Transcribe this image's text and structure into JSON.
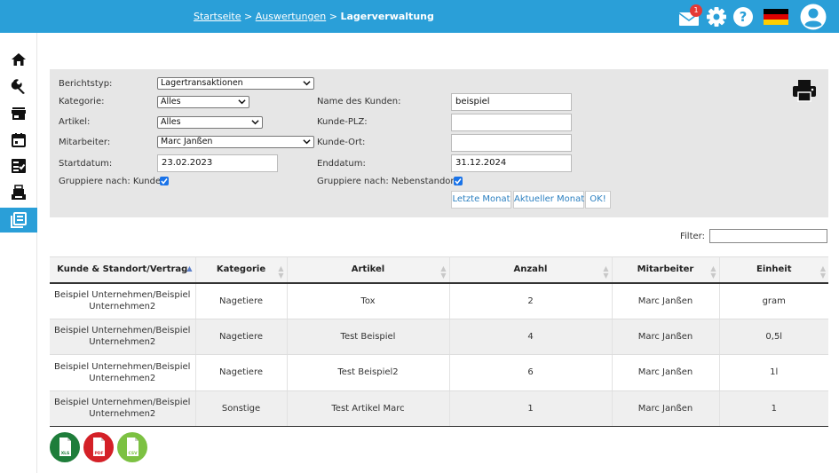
{
  "header": {
    "breadcrumb": {
      "home": "Startseite",
      "sep1": ">",
      "reports": "Auswertungen",
      "sep2": ">",
      "current": "Lagerverwaltung"
    },
    "mail_badge": "1",
    "accent": "#2a9fd8"
  },
  "sidebar": {
    "items": [
      {
        "name": "home-icon"
      },
      {
        "name": "wrench-icon"
      },
      {
        "name": "store-icon"
      },
      {
        "name": "calendar-icon"
      },
      {
        "name": "checklist-icon"
      },
      {
        "name": "register-icon"
      },
      {
        "name": "report-icon",
        "active": true
      }
    ]
  },
  "filters": {
    "report_type": {
      "label": "Berichtstyp:",
      "value": "Lagertransaktionen"
    },
    "category": {
      "label": "Kategorie:",
      "value": "Alles"
    },
    "article": {
      "label": "Artikel:",
      "value": "Alles"
    },
    "employee": {
      "label": "Mitarbeiter:",
      "value": "Marc Janßen"
    },
    "start_date": {
      "label": "Startdatum:",
      "value": "23.02.2023"
    },
    "group_customer": {
      "label": "Gruppiere nach: Kunde:",
      "checked": true
    },
    "customer_name": {
      "label": "Name des Kunden:",
      "value": "beispiel"
    },
    "customer_zip": {
      "label": "Kunde-PLZ:",
      "value": ""
    },
    "customer_city": {
      "label": "Kunde-Ort:",
      "value": ""
    },
    "end_date": {
      "label": "Enddatum:",
      "value": "31.12.2024"
    },
    "group_site": {
      "label": "Gruppiere nach: Nebenstandort:",
      "checked": true
    },
    "buttons": {
      "last_month": "Letzte Monat",
      "current_month": "Aktueller Monat",
      "ok": "OK!"
    }
  },
  "table_filter": {
    "label": "Filter:",
    "value": ""
  },
  "table": {
    "columns": [
      "Kunde & Standort/Vertrag",
      "Kategorie",
      "Artikel",
      "Anzahl",
      "Mitarbeiter",
      "Einheit"
    ],
    "rows": [
      {
        "customer": "Beispiel Unternehmen/Beispiel Unternehmen2",
        "category": "Nagetiere",
        "article": "Tox",
        "count": "2",
        "employee": "Marc Janßen",
        "unit": "gram"
      },
      {
        "customer": "Beispiel Unternehmen/Beispiel Unternehmen2",
        "category": "Nagetiere",
        "article": "Test Beispiel",
        "count": "4",
        "employee": "Marc Janßen",
        "unit": "0,5l"
      },
      {
        "customer": "Beispiel Unternehmen/Beispiel Unternehmen2",
        "category": "Nagetiere",
        "article": "Test Beispiel2",
        "count": "6",
        "employee": "Marc Janßen",
        "unit": "1l"
      },
      {
        "customer": "Beispiel Unternehmen/Beispiel Unternehmen2",
        "category": "Sonstige",
        "article": "Test Artikel Marc",
        "count": "1",
        "employee": "Marc Janßen",
        "unit": "1"
      }
    ]
  },
  "export": {
    "xls": "XLS",
    "pdf": "PDF",
    "csv": "CSV"
  }
}
